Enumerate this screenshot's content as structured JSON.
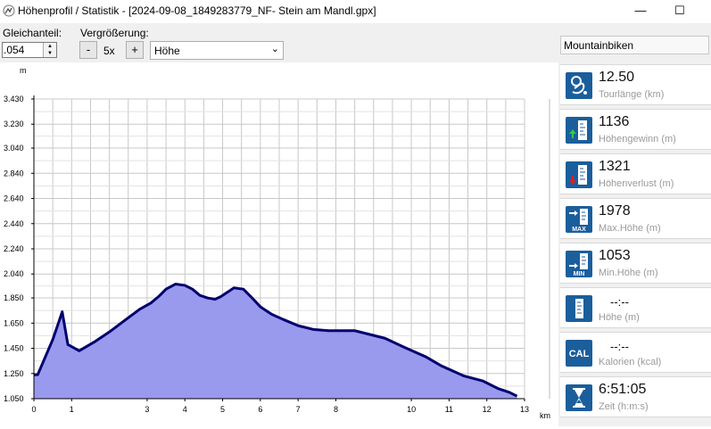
{
  "window": {
    "title": "Höhenprofil / Statistik - [2024-09-08_1849283779_NF- Stein am Mandl.gpx]",
    "minimize": "—",
    "maximize": "☐"
  },
  "toolbar": {
    "gleichanteil_label": "Gleichanteil:",
    "gleichanteil_value": ".054",
    "vergroesserung_label": "Vergrößerung:",
    "minus_label": "-",
    "zoom_value": "5x",
    "plus_label": "+",
    "mode_select_value": "Höhe"
  },
  "activity": {
    "value": "Mountainbiken"
  },
  "stats": [
    {
      "icon": "route-icon",
      "value": "12.50",
      "label": "Tourlänge (km)"
    },
    {
      "icon": "elevation-gain-icon",
      "value": "1136",
      "label": "Höhengewinn (m)"
    },
    {
      "icon": "elevation-loss-icon",
      "value": "1321",
      "label": "Höhenverlust (m)"
    },
    {
      "icon": "max-height-icon",
      "value": "1978",
      "label": "Max.Höhe (m)"
    },
    {
      "icon": "min-height-icon",
      "value": "1053",
      "label": "Min.Höhe (m)"
    },
    {
      "icon": "height-icon",
      "value": "--:--",
      "label": "Höhe (m)"
    },
    {
      "icon": "calories-icon",
      "value": "--:--",
      "label": "Kalorien (kcal)"
    },
    {
      "icon": "hourglass-icon",
      "value": "6:51:05",
      "label": "Zeit (h:m:s)"
    }
  ],
  "icon_text": {
    "max": "MAX",
    "min": "MIN",
    "cal": "CAL"
  },
  "colors": {
    "fill": "#9999ee",
    "line": "#00006e",
    "icon_bg": "#1b5e9c",
    "grid": "#c8c8c8"
  },
  "chart_data": {
    "type": "area",
    "xlabel": "km",
    "ylabel": "m",
    "yticks": [
      "3.430",
      "3.230",
      "3.040",
      "2.840",
      "2.640",
      "2.440",
      "2.240",
      "2.040",
      "1.850",
      "1.650",
      "1.450",
      "1.250",
      "1.050"
    ],
    "ytick_values": [
      3430,
      3230,
      3040,
      2840,
      2640,
      2440,
      2240,
      2040,
      1850,
      1650,
      1450,
      1250,
      1050
    ],
    "xticks": [
      "0",
      "1",
      "3",
      "4",
      "5",
      "6",
      "7",
      "8",
      "10",
      "11",
      "12",
      "13"
    ],
    "xtick_values": [
      0,
      1,
      3,
      4,
      5,
      6,
      7,
      8,
      10,
      11,
      12,
      13
    ],
    "xlim": [
      0,
      13
    ],
    "ylim": [
      1050,
      3430
    ],
    "grid": true,
    "x": [
      0,
      0.1,
      0.3,
      0.5,
      0.65,
      0.75,
      0.9,
      1.2,
      1.6,
      2.0,
      2.4,
      2.8,
      3.1,
      3.3,
      3.5,
      3.75,
      4.0,
      4.2,
      4.4,
      4.6,
      4.8,
      4.95,
      5.1,
      5.3,
      5.55,
      5.75,
      6.0,
      6.3,
      6.6,
      7.0,
      7.4,
      7.8,
      8.2,
      8.5,
      8.9,
      9.3,
      9.8,
      10.4,
      10.8,
      11.4,
      11.9,
      12.3,
      12.6,
      12.8
    ],
    "y": [
      1240,
      1240,
      1380,
      1520,
      1650,
      1740,
      1480,
      1430,
      1500,
      1580,
      1670,
      1760,
      1810,
      1860,
      1920,
      1960,
      1950,
      1920,
      1870,
      1850,
      1840,
      1860,
      1890,
      1930,
      1920,
      1860,
      1780,
      1720,
      1680,
      1630,
      1600,
      1590,
      1590,
      1590,
      1560,
      1530,
      1460,
      1380,
      1310,
      1230,
      1190,
      1130,
      1100,
      1070
    ]
  }
}
